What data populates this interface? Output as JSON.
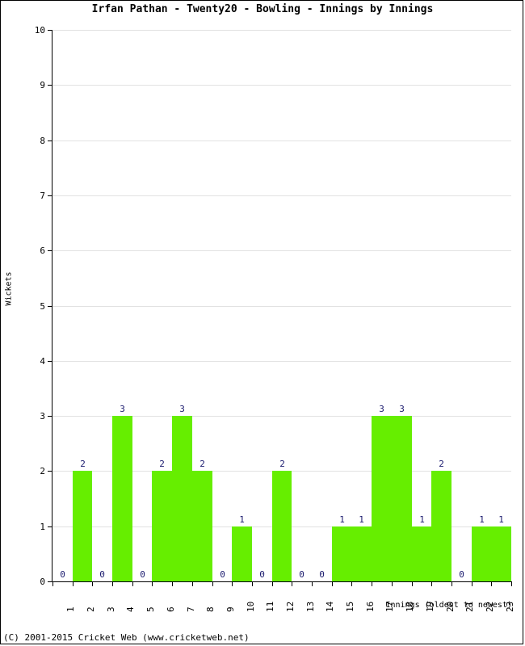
{
  "chart_data": {
    "type": "bar",
    "title": "Irfan Pathan - Twenty20 - Bowling - Innings by Innings",
    "xlabel": "Innings (oldest to newest)",
    "ylabel": "Wickets",
    "categories": [
      "1",
      "2",
      "3",
      "4",
      "5",
      "6",
      "7",
      "8",
      "9",
      "10",
      "11",
      "12",
      "13",
      "14",
      "15",
      "16",
      "17",
      "18",
      "19",
      "20",
      "21",
      "22",
      "23"
    ],
    "values": [
      0,
      2,
      0,
      3,
      0,
      2,
      3,
      2,
      0,
      1,
      0,
      2,
      0,
      0,
      1,
      1,
      3,
      3,
      1,
      2,
      0,
      1,
      1
    ],
    "value_labels": [
      "0",
      "2",
      "0",
      "3",
      "0",
      "2",
      "3",
      "2",
      "0",
      "1",
      "0",
      "2",
      "0",
      "0",
      "1",
      "1",
      "3",
      "3",
      "1",
      "2",
      "0",
      "1",
      "1"
    ],
    "ylim": [
      0,
      10
    ],
    "ytick_labels": [
      "0",
      "1",
      "2",
      "3",
      "4",
      "5",
      "6",
      "7",
      "8",
      "9",
      "10"
    ],
    "ytick_values": [
      0,
      1,
      2,
      3,
      4,
      5,
      6,
      7,
      8,
      9,
      10
    ],
    "grid": true,
    "legend": "none",
    "bar_color": "#66ee00",
    "label_color": "#1a1a6e",
    "grid_color": "#e2e2e2",
    "axis_color": "#000000"
  },
  "footer": {
    "copyright": "(C) 2001-2015 Cricket Web (www.cricketweb.net)"
  }
}
